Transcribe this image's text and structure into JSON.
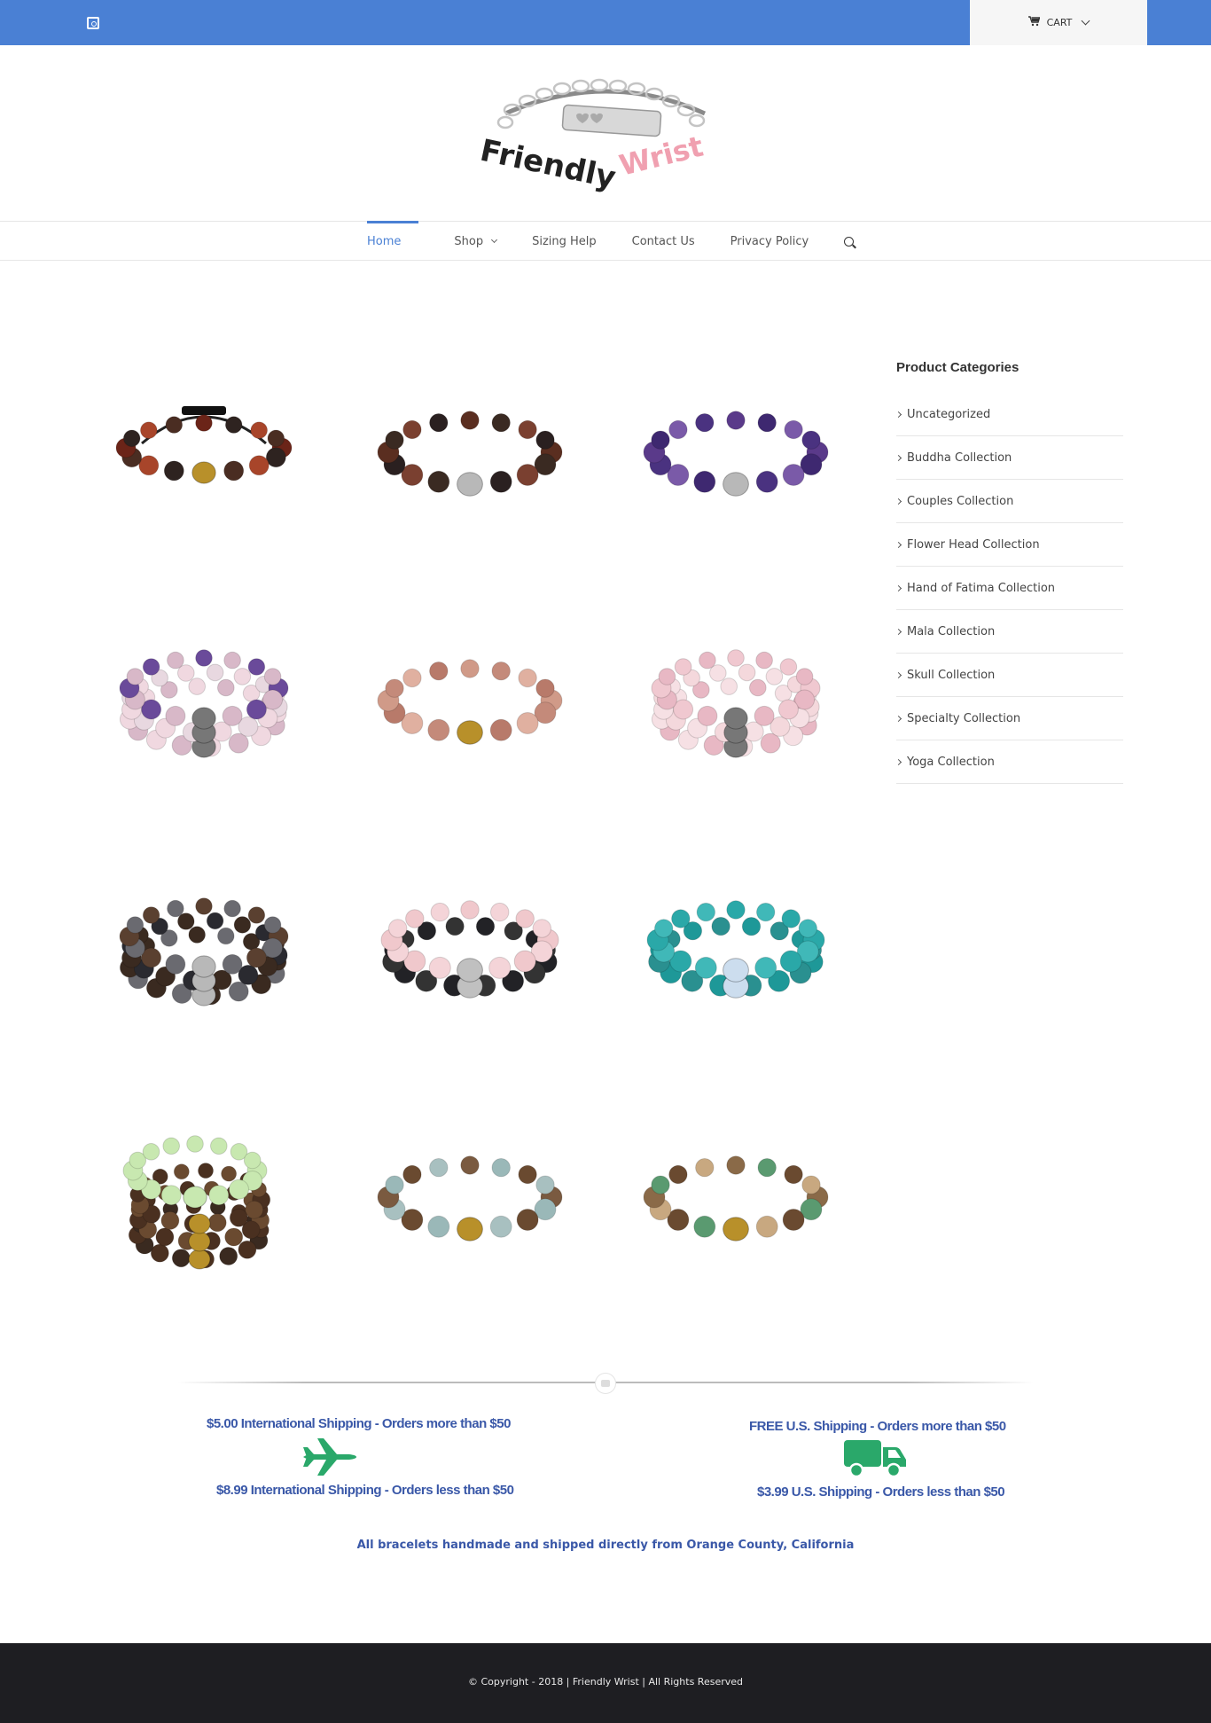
{
  "topbar": {
    "social_icon": "instagram-icon",
    "cart_label": "CART",
    "cart_icon": "shopping-cart-icon"
  },
  "logo": {
    "word1": "Friendly",
    "word2": "Wrist"
  },
  "nav": {
    "items": [
      {
        "label": "Home"
      },
      {
        "label": "Shop"
      },
      {
        "label": "Sizing Help"
      },
      {
        "label": "Contact Us"
      },
      {
        "label": "Privacy Policy"
      }
    ],
    "search_icon": "search-icon"
  },
  "products": [
    {
      "style": "adjustable",
      "colors": [
        "#6b2418",
        "#2e2320",
        "#a8452a",
        "#4a2d22"
      ],
      "accent": "#b8902a"
    },
    {
      "style": "single",
      "colors": [
        "#5a2e20",
        "#3a2a22",
        "#7a4030",
        "#2a2020"
      ],
      "accent": "#b8b8b8"
    },
    {
      "style": "single",
      "colors": [
        "#5a3a8a",
        "#3e2870",
        "#7a5aa8",
        "#4a3280"
      ],
      "accent": "#b8b8b8"
    },
    {
      "style": "stack3",
      "colors": [
        "#6a4a9a",
        "#e8d8e0",
        "#d8b8c8",
        "#f0d8e0"
      ],
      "accent": "#777"
    },
    {
      "style": "single",
      "colors": [
        "#d09a88",
        "#c48a7a",
        "#e0b0a0",
        "#b87a6a"
      ],
      "accent": "#b8902a"
    },
    {
      "style": "stack3",
      "colors": [
        "#f0c8d0",
        "#f4d8dc",
        "#e8b8c4",
        "#f6e0e4"
      ],
      "accent": "#777"
    },
    {
      "style": "stack3",
      "colors": [
        "#5a4030",
        "#2a2a30",
        "#6a6a70",
        "#3a2a20"
      ],
      "accent": "#b8b8b8"
    },
    {
      "style": "stack2",
      "colors": [
        "#f0c8cc",
        "#222226",
        "#f4d4d8",
        "#333"
      ],
      "accent": "#c0c0c0"
    },
    {
      "style": "stack2",
      "colors": [
        "#2aa8a8",
        "#1e9898",
        "#40b8b8",
        "#2a9090"
      ],
      "accent": "#cde"
    },
    {
      "style": "stack4",
      "colors": [
        "#c8e8b0",
        "#4a3020",
        "#6a4a30",
        "#3a2a20"
      ],
      "accent": "#b8902a"
    },
    {
      "style": "single",
      "colors": [
        "#7a5a40",
        "#9ab8b8",
        "#6a4a30",
        "#a8c0c0"
      ],
      "accent": "#b8902a"
    },
    {
      "style": "single",
      "colors": [
        "#8a6a48",
        "#5a9a70",
        "#6a4a30",
        "#c8a880"
      ],
      "accent": "#b8902a"
    }
  ],
  "sidebar": {
    "title": "Product Categories",
    "categories": [
      "Uncategorized",
      "Buddha Collection",
      "Couples Collection",
      "Flower Head Collection",
      "Hand of Fatima Collection",
      "Mala Collection",
      "Skull Collection",
      "Specialty Collection",
      "Yoga Collection"
    ]
  },
  "shipping": {
    "intl_more": "$5.00 International Shipping - Orders more than $50",
    "intl_less": "$8.99 International Shipping - Orders less than $50",
    "us_more": "FREE U.S. Shipping - Orders more than $50",
    "us_less": "$3.99 U.S. Shipping - Orders less than $50",
    "plane_icon": "airplane-icon",
    "truck_icon": "truck-icon",
    "icon_color": "#2aa86a"
  },
  "tagline": "All bracelets handmade and shipped directly from Orange County, California",
  "footer": {
    "copyright": "© Copyright - 2018 | Friendly Wrist | All Rights Reserved"
  },
  "colors": {
    "brand_blue": "#4a80d4",
    "text_blue": "#3a58a8",
    "footer_bg": "#1e1e22",
    "logo_pink": "#f0a0b0"
  }
}
